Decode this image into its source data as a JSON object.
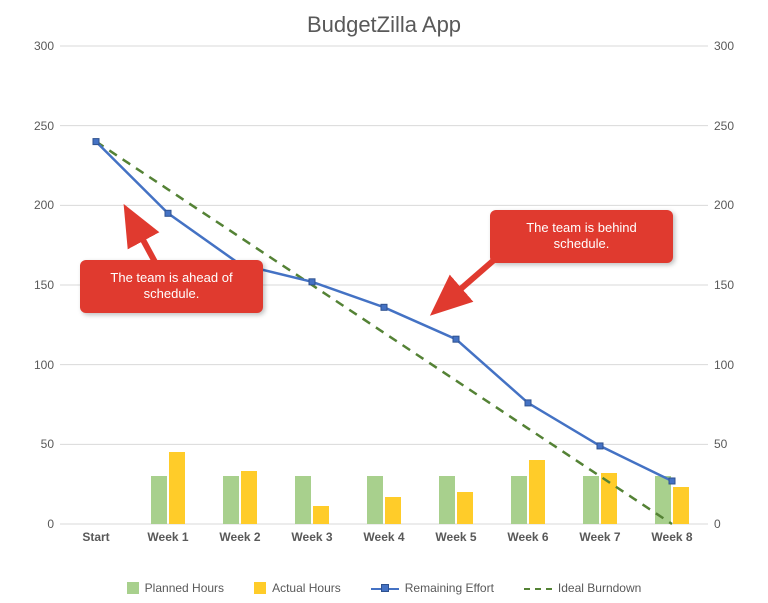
{
  "title": "BudgetZilla App",
  "chart_data": {
    "type": "combo-bar-line",
    "categories": [
      "Start",
      "Week 1",
      "Week 2",
      "Week 3",
      "Week 4",
      "Week 5",
      "Week 6",
      "Week 7",
      "Week 8"
    ],
    "ylim": [
      0,
      300
    ],
    "yticks": [
      0,
      50,
      100,
      150,
      200,
      250,
      300
    ],
    "series": [
      {
        "name": "Planned Hours",
        "type": "bar",
        "color": "#a8d08d",
        "values": [
          null,
          30,
          30,
          30,
          30,
          30,
          30,
          30,
          30
        ]
      },
      {
        "name": "Actual Hours",
        "type": "bar",
        "color": "#ffcc29",
        "values": [
          null,
          45,
          33,
          11,
          17,
          20,
          40,
          32,
          23
        ]
      },
      {
        "name": "Remaining Effort",
        "type": "line",
        "color": "#4472c4",
        "style": "solid",
        "marker": true,
        "values": [
          240,
          195,
          163,
          152,
          136,
          116,
          76,
          49,
          27
        ]
      },
      {
        "name": "Ideal Burndown",
        "type": "line",
        "color": "#548235",
        "style": "dashed",
        "marker": false,
        "values": [
          240,
          210,
          180,
          150,
          120,
          90,
          60,
          30,
          0
        ]
      }
    ],
    "annotations": [
      {
        "text": "The team is ahead of schedule.",
        "points_to_category": "Week 1",
        "points_to_series": "Remaining Effort"
      },
      {
        "text": "The team is behind schedule.",
        "points_to_category": "Week 5",
        "points_to_series": "Remaining Effort"
      }
    ]
  },
  "legend": {
    "planned": "Planned Hours",
    "actual": "Actual Hours",
    "remaining": "Remaining Effort",
    "ideal": "Ideal Burndown"
  },
  "callouts": {
    "ahead": "The team is ahead of\nschedule.",
    "behind": "The team is behind\nschedule."
  },
  "colors": {
    "planned": "#a8d08d",
    "actual": "#ffcc29",
    "remaining": "#4472c4",
    "ideal": "#548235",
    "callout": "#e03a2f"
  }
}
